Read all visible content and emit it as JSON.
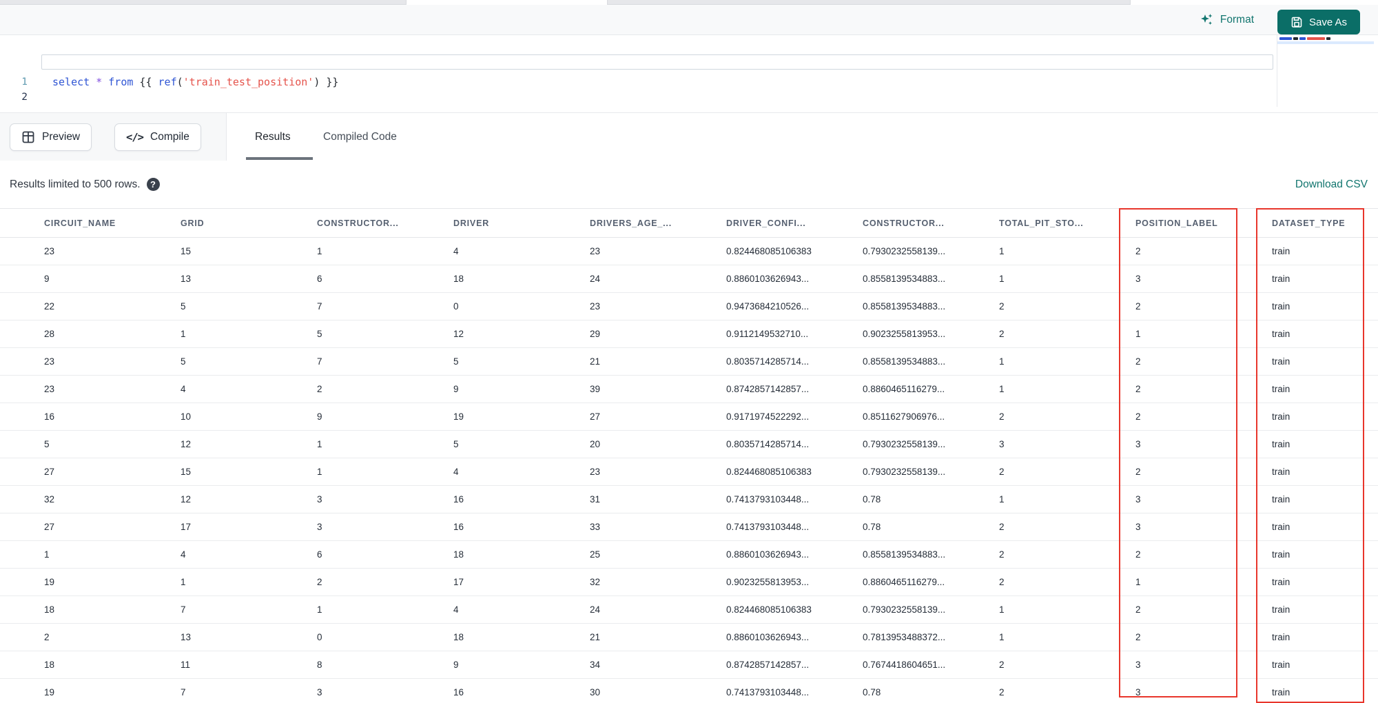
{
  "colors": {
    "accent_teal": "#11756e",
    "accent_teal_dark": "#0b6e67",
    "highlight_red": "#e8352b"
  },
  "header": {
    "format_label": "Format",
    "save_as_label": "Save As"
  },
  "editor": {
    "lines": [
      {
        "number": "1"
      },
      {
        "number": "2"
      }
    ],
    "code_text": "select * from {{ ref('train_test_position') }}",
    "code_tokens": [
      {
        "text": "select",
        "type": "keyword"
      },
      {
        "text": " ",
        "type": "plain"
      },
      {
        "text": "*",
        "type": "operator"
      },
      {
        "text": " ",
        "type": "plain"
      },
      {
        "text": "from",
        "type": "keyword"
      },
      {
        "text": " {{ ",
        "type": "plain"
      },
      {
        "text": "ref",
        "type": "function"
      },
      {
        "text": "(",
        "type": "plain"
      },
      {
        "text": "'train_test_position'",
        "type": "string"
      },
      {
        "text": ")",
        "type": "plain"
      },
      {
        "text": " }}",
        "type": "plain"
      }
    ]
  },
  "toolbar": {
    "preview_label": "Preview",
    "compile_label": "Compile",
    "compile_glyph": "</>",
    "tabs": [
      {
        "label": "Results",
        "active": true
      },
      {
        "label": "Compiled Code",
        "active": false
      }
    ]
  },
  "results": {
    "limit_note": "Results limited to 500 rows.",
    "help_glyph": "?",
    "download_csv_label": "Download CSV"
  },
  "table": {
    "columns": [
      "CIRCUIT_NAME",
      "GRID",
      "CONSTRUCTOR...",
      "DRIVER",
      "DRIVERS_AGE_...",
      "DRIVER_CONFI...",
      "CONSTRUCTOR...",
      "TOTAL_PIT_STO...",
      "POSITION_LABEL",
      "DATASET_TYPE"
    ],
    "highlighted_columns": [
      "POSITION_LABEL",
      "DATASET_TYPE"
    ],
    "rows": [
      [
        "23",
        "15",
        "1",
        "4",
        "23",
        "0.824468085106383",
        "0.7930232558139...",
        "1",
        "2",
        "train"
      ],
      [
        "9",
        "13",
        "6",
        "18",
        "24",
        "0.8860103626943...",
        "0.8558139534883...",
        "1",
        "3",
        "train"
      ],
      [
        "22",
        "5",
        "7",
        "0",
        "23",
        "0.9473684210526...",
        "0.8558139534883...",
        "2",
        "2",
        "train"
      ],
      [
        "28",
        "1",
        "5",
        "12",
        "29",
        "0.9112149532710...",
        "0.9023255813953...",
        "2",
        "1",
        "train"
      ],
      [
        "23",
        "5",
        "7",
        "5",
        "21",
        "0.8035714285714...",
        "0.8558139534883...",
        "1",
        "2",
        "train"
      ],
      [
        "23",
        "4",
        "2",
        "9",
        "39",
        "0.8742857142857...",
        "0.8860465116279...",
        "1",
        "2",
        "train"
      ],
      [
        "16",
        "10",
        "9",
        "19",
        "27",
        "0.9171974522292...",
        "0.8511627906976...",
        "2",
        "2",
        "train"
      ],
      [
        "5",
        "12",
        "1",
        "5",
        "20",
        "0.8035714285714...",
        "0.7930232558139...",
        "3",
        "3",
        "train"
      ],
      [
        "27",
        "15",
        "1",
        "4",
        "23",
        "0.824468085106383",
        "0.7930232558139...",
        "2",
        "2",
        "train"
      ],
      [
        "32",
        "12",
        "3",
        "16",
        "31",
        "0.7413793103448...",
        "0.78",
        "1",
        "3",
        "train"
      ],
      [
        "27",
        "17",
        "3",
        "16",
        "33",
        "0.7413793103448...",
        "0.78",
        "2",
        "3",
        "train"
      ],
      [
        "1",
        "4",
        "6",
        "18",
        "25",
        "0.8860103626943...",
        "0.8558139534883...",
        "2",
        "2",
        "train"
      ],
      [
        "19",
        "1",
        "2",
        "17",
        "32",
        "0.9023255813953...",
        "0.8860465116279...",
        "2",
        "1",
        "train"
      ],
      [
        "18",
        "7",
        "1",
        "4",
        "24",
        "0.824468085106383",
        "0.7930232558139...",
        "1",
        "2",
        "train"
      ],
      [
        "2",
        "13",
        "0",
        "18",
        "21",
        "0.8860103626943...",
        "0.7813953488372...",
        "1",
        "2",
        "train"
      ],
      [
        "18",
        "11",
        "8",
        "9",
        "34",
        "0.8742857142857...",
        "0.7674418604651...",
        "2",
        "3",
        "train"
      ],
      [
        "19",
        "7",
        "3",
        "16",
        "30",
        "0.7413793103448...",
        "0.78",
        "2",
        "3",
        "train"
      ]
    ]
  }
}
